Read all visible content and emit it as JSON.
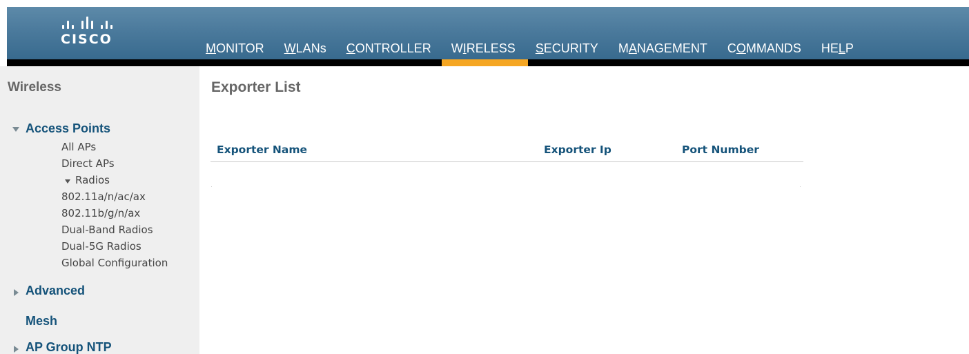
{
  "header": {
    "logo_text": "CISCO",
    "nav": [
      {
        "pre": "",
        "u": "M",
        "post": "ONITOR"
      },
      {
        "pre": "",
        "u": "W",
        "post": "LANs"
      },
      {
        "pre": "",
        "u": "C",
        "post": "ONTROLLER"
      },
      {
        "pre": "W",
        "u": "I",
        "post": "RELESS"
      },
      {
        "pre": "",
        "u": "S",
        "post": "ECURITY"
      },
      {
        "pre": "M",
        "u": "A",
        "post": "NAGEMENT"
      },
      {
        "pre": "C",
        "u": "O",
        "post": "MMANDS"
      },
      {
        "pre": "HE",
        "u": "L",
        "post": "P"
      }
    ],
    "active_nav": "WIRELESS",
    "accent_color": "#f5a623"
  },
  "sidebar": {
    "title": "Wireless",
    "access_points": {
      "label": "Access Points",
      "items": [
        "All APs",
        "Direct APs"
      ],
      "radios": {
        "label": "Radios",
        "items": [
          "802.11a/n/ac/ax",
          "802.11b/g/n/ax",
          "Dual-Band Radios",
          "Dual-5G Radios"
        ]
      },
      "global": "Global Configuration"
    },
    "advanced": "Advanced",
    "mesh": "Mesh",
    "ap_group_ntp": "AP Group NTP"
  },
  "main": {
    "title": "Exporter List",
    "columns": [
      "Exporter Name",
      "Exporter Ip",
      "Port Number"
    ],
    "rows": []
  }
}
